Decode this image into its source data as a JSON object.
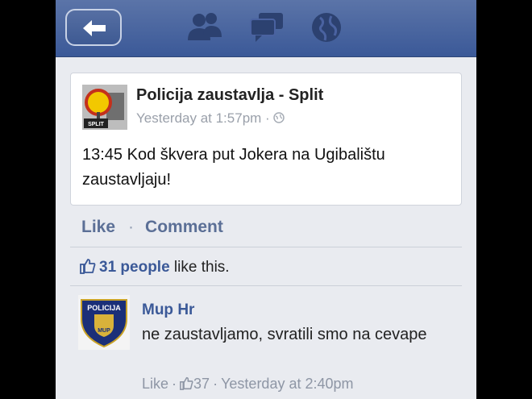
{
  "post": {
    "page_name": "Policija zaustavlja - Split",
    "avatar_caption": "SPLIT",
    "timestamp": "Yesterday at 1:57pm",
    "timestamp_sep": "·",
    "audience_icon": "globe-icon",
    "text": "13:45 Kod škvera put Jokera na Ugibalištu zaustavljaju!"
  },
  "actions": {
    "like_label": "Like",
    "separator": "·",
    "comment_label": "Comment"
  },
  "likes": {
    "count_text": "31 people",
    "suffix": " like this."
  },
  "comment": {
    "author": "Mup Hr",
    "avatar_text": "POLICIJA",
    "avatar_sub": "MUP",
    "text": "ne zaustavljamo, svratili smo na cevape",
    "like_label": "Like",
    "separator": "·",
    "like_count": "37",
    "separator2": "·",
    "timestamp": "Yesterday at 2:40pm"
  },
  "nav": {
    "icons": [
      "back-arrow-icon",
      "friends-icon",
      "messages-icon",
      "globe-icon"
    ]
  },
  "colors": {
    "header": "#3b5998",
    "link": "#3b5998",
    "background": "#e9ebf0"
  }
}
